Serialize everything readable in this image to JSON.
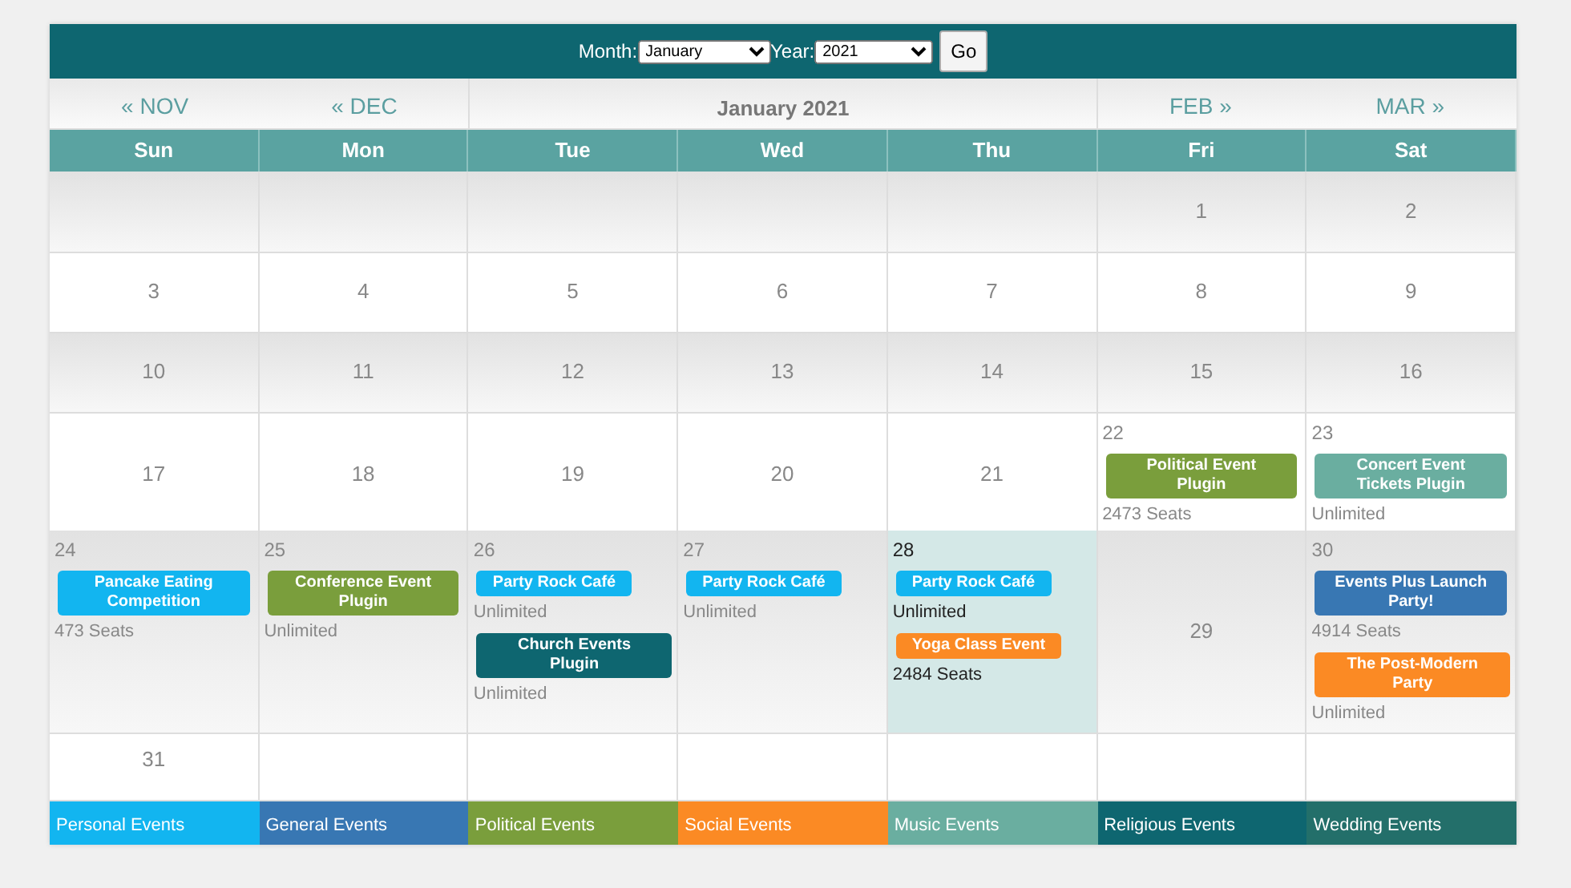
{
  "header": {
    "month_label": "Month:",
    "month_value": "January",
    "year_label": "Year:",
    "year_value": "2021",
    "go_button": "Go"
  },
  "nav": {
    "prev": [
      "« NOV",
      "« DEC"
    ],
    "title": "January 2021",
    "next": [
      "FEB »",
      "MAR »"
    ]
  },
  "weekdays": [
    "Sun",
    "Mon",
    "Tue",
    "Wed",
    "Thu",
    "Fri",
    "Sat"
  ],
  "weeks": [
    {
      "days": [
        {
          "today": false
        },
        {
          "today": false
        },
        {
          "today": false
        },
        {
          "today": false
        },
        {
          "today": false
        },
        {
          "day": "1",
          "today": false
        },
        {
          "day": "2",
          "today": false
        }
      ]
    },
    {
      "days": [
        {
          "day": "3",
          "today": false
        },
        {
          "day": "4",
          "today": false
        },
        {
          "day": "5",
          "today": false
        },
        {
          "day": "6",
          "today": false
        },
        {
          "day": "7",
          "today": false
        },
        {
          "day": "8",
          "today": false
        },
        {
          "day": "9",
          "today": false
        }
      ]
    },
    {
      "days": [
        {
          "day": "10",
          "today": false
        },
        {
          "day": "11",
          "today": false
        },
        {
          "day": "12",
          "today": false
        },
        {
          "day": "13",
          "today": false
        },
        {
          "day": "14",
          "today": false
        },
        {
          "day": "15",
          "today": false
        },
        {
          "day": "16",
          "today": false
        }
      ]
    },
    {
      "days": [
        {
          "day": "17",
          "today": false
        },
        {
          "day": "18",
          "today": false
        },
        {
          "day": "19",
          "today": false
        },
        {
          "day": "20",
          "today": false
        },
        {
          "day": "21",
          "today": false
        },
        {
          "day": "22",
          "today": false,
          "events": [
            {
              "title": "Political Event  Plugin",
              "seats": "2473 Seats",
              "color": "#7a9e3c"
            }
          ]
        },
        {
          "day": "23",
          "today": false,
          "events": [
            {
              "title": "Concert Event Tickets Plugin",
              "seats": "Unlimited",
              "color": "#6aaea0"
            }
          ]
        }
      ]
    },
    {
      "days": [
        {
          "day": "24",
          "today": false,
          "events": [
            {
              "title": "Pancake Eating Competition",
              "seats": "473 Seats",
              "color": "#12b5f0"
            }
          ]
        },
        {
          "day": "25",
          "today": false,
          "events": [
            {
              "title": "Conference Event Plugin",
              "seats": "Unlimited",
              "color": "#7a9e3c"
            }
          ]
        },
        {
          "day": "26",
          "today": false,
          "events": [
            {
              "title": "Party Rock Café",
              "seats": "Unlimited",
              "color": "#12b5f0"
            },
            {
              "title": "Church Events Plugin",
              "seats": "Unlimited",
              "color": "#0e6670"
            }
          ]
        },
        {
          "day": "27",
          "today": false,
          "events": [
            {
              "title": "Party Rock Café",
              "seats": "Unlimited",
              "color": "#12b5f0"
            }
          ]
        },
        {
          "day": "28",
          "today": true,
          "events": [
            {
              "title": "Party Rock Café",
              "seats": "Unlimited",
              "color": "#12b5f0"
            },
            {
              "title": "Yoga Class Event",
              "seats": "2484 Seats",
              "color": "#fb8a24"
            }
          ]
        },
        {
          "day": "29",
          "today": false
        },
        {
          "day": "30",
          "today": false,
          "events": [
            {
              "title": "Events Plus Launch Party!",
              "seats": "4914 Seats",
              "color": "#3877b3"
            },
            {
              "title": "The Post-Modern Party",
              "seats": "Unlimited",
              "color": "#fb8a24"
            }
          ]
        }
      ]
    },
    {
      "days": [
        {
          "day": "31",
          "today": false
        },
        {
          "today": false
        },
        {
          "today": false
        },
        {
          "today": false
        },
        {
          "today": false
        },
        {
          "today": false
        },
        {
          "today": false
        }
      ]
    }
  ],
  "legend": [
    {
      "label": "Personal Events",
      "color": "#12b5f0"
    },
    {
      "label": "General Events",
      "color": "#3877b3"
    },
    {
      "label": "Political Events",
      "color": "#7a9e3c"
    },
    {
      "label": "Social Events",
      "color": "#fb8a24"
    },
    {
      "label": "Music Events",
      "color": "#6aaea0"
    },
    {
      "label": "Religious Events",
      "color": "#0e6670"
    },
    {
      "label": "Wedding Events",
      "color": "#236f6a"
    }
  ]
}
